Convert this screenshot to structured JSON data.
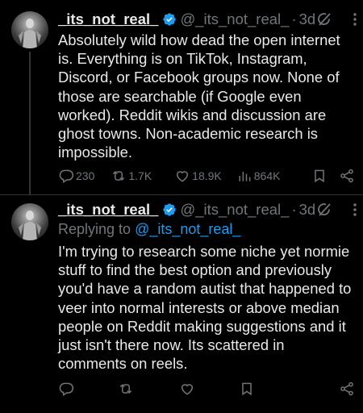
{
  "tweets": [
    {
      "name": "_its_not_real_",
      "handle": "@_its_not_real_",
      "time": "3d",
      "text": "Absolutely wild how dead the open internet is. Everything is on TikTok, Instagram, Discord, or Facebook groups now. None of those are searchable (if Google even worked). Reddit wikis and discussion are ghost towns. Non-academic research is impossible.",
      "replies": "230",
      "reposts": "1.7K",
      "likes": "18.9K",
      "views": "864K"
    },
    {
      "name": "_its_not_real_",
      "handle": "@_its_not_real_",
      "time": "3d",
      "replying_prefix": "Replying to ",
      "replying_to": "@_its_not_real_",
      "text": "I'm trying to research some niche yet normie stuff to find the best option and previously you'd have a random autist that happened to veer into normal interests or above median people on Reddit making suggestions and it just isn't there now. Its scattered in comments on reels."
    }
  ],
  "separator": "·",
  "icons": [
    "grok-icon",
    "more-icon",
    "verified-icon",
    "reply-icon",
    "repost-icon",
    "like-icon",
    "views-icon",
    "bookmark-icon",
    "share-icon"
  ],
  "colors": {
    "background": "#000000",
    "text": "#e7e9ea",
    "muted": "#71767b",
    "accent": "#1d9bf0"
  }
}
